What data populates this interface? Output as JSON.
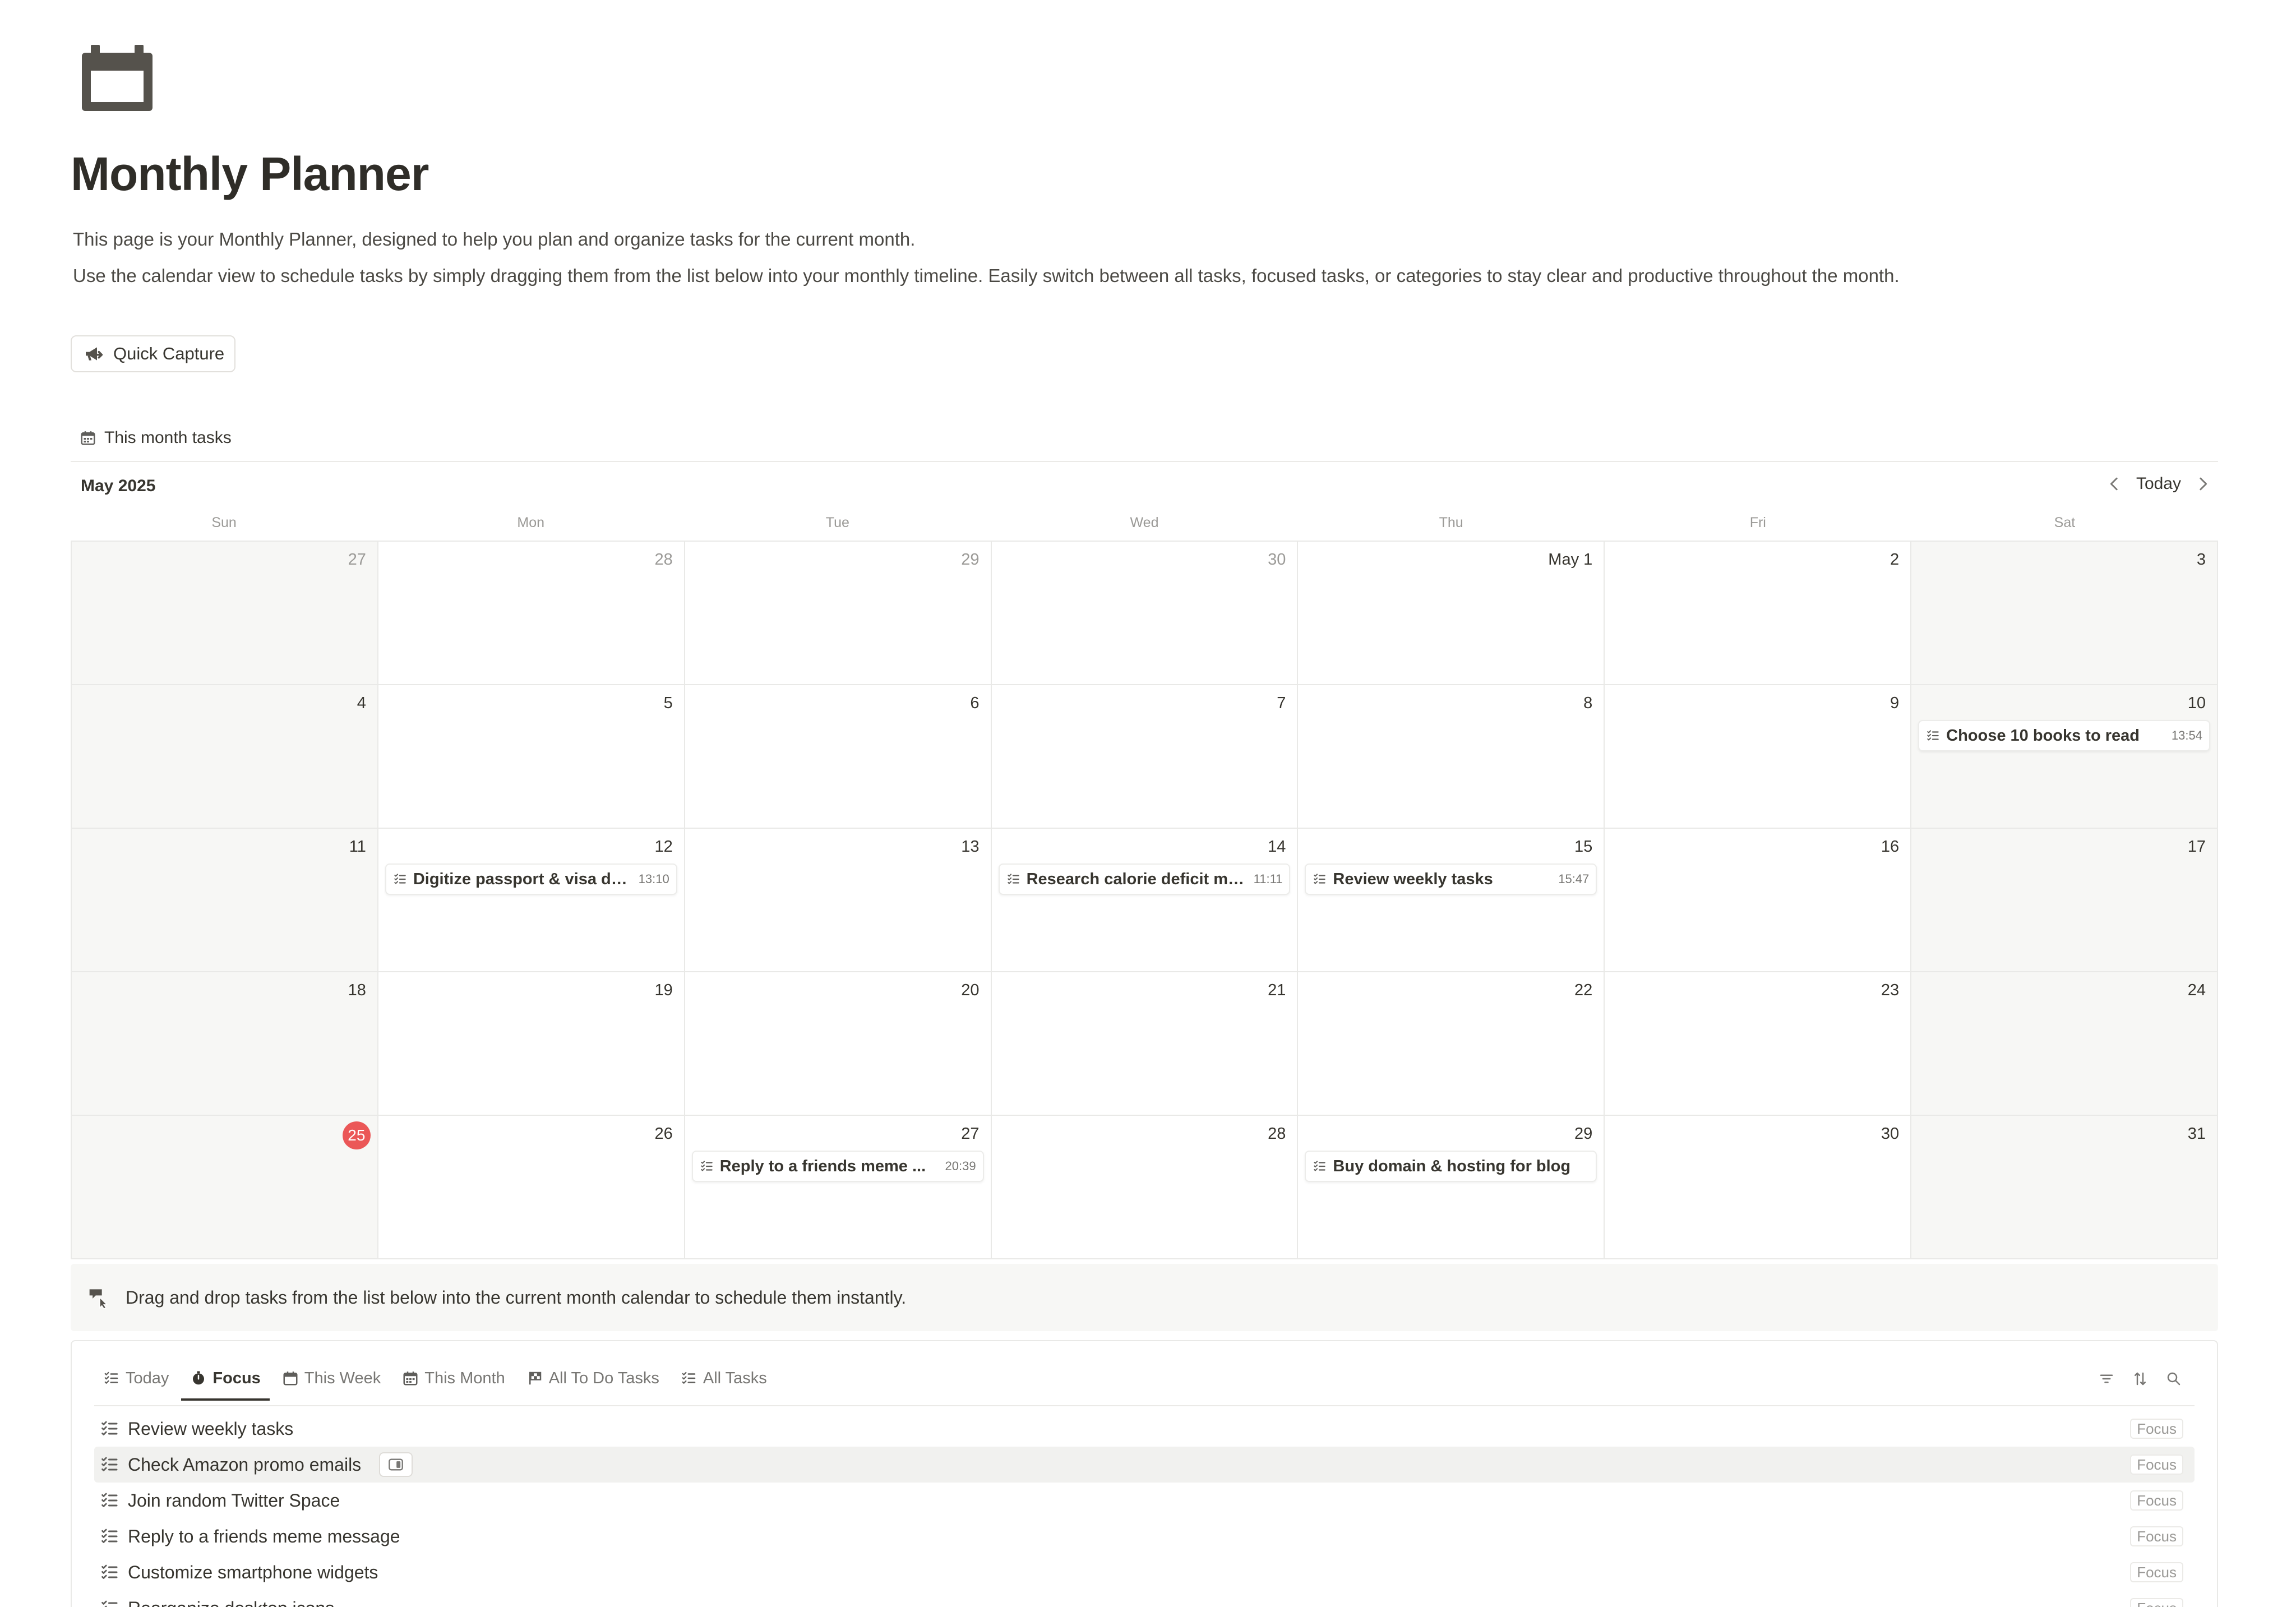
{
  "page": {
    "icon": "calendar-icon",
    "title": "Monthly Planner",
    "description_1": "This page is your Monthly Planner, designed to help you plan and organize tasks for the current month.",
    "description_2": "Use the calendar view to schedule tasks by simply dragging them from the list below into your monthly timeline. Easily switch between all tasks, focused tasks, or categories to stay clear and productive throughout the month."
  },
  "quick_capture": {
    "label": "Quick Capture",
    "icon": "megaphone-arrow-icon"
  },
  "calendar_view": {
    "title": "This month tasks",
    "month": "May 2025",
    "today_label": "Today",
    "weekdays": [
      "Sun",
      "Mon",
      "Tue",
      "Wed",
      "Thu",
      "Fri",
      "Sat"
    ],
    "days": [
      "27",
      "28",
      "29",
      "30",
      "May 1",
      "2",
      "3",
      "4",
      "5",
      "6",
      "7",
      "8",
      "9",
      "10",
      "11",
      "12",
      "13",
      "14",
      "15",
      "16",
      "17",
      "18",
      "19",
      "20",
      "21",
      "22",
      "23",
      "24",
      "25",
      "26",
      "27",
      "28",
      "29",
      "30",
      "31"
    ],
    "events": {
      "10": {
        "title": "Choose 10 books to read",
        "time": "13:54"
      },
      "12": {
        "title": "Digitize passport & visa do...",
        "time": "13:10"
      },
      "14": {
        "title": "Research calorie deficit me...",
        "time": "11:11"
      },
      "15": {
        "title": "Review weekly tasks",
        "time": "15:47"
      },
      "27": {
        "title": "Reply to a friends meme ...",
        "time": "20:39"
      },
      "29": {
        "title": "Buy domain & hosting for blog",
        "time": ""
      }
    },
    "today_day": "25"
  },
  "callout": {
    "icon": "hand-pointer-icon",
    "text": "Drag and drop tasks from the list below into the current month calendar to schedule them instantly."
  },
  "task_list": {
    "tabs": [
      {
        "label": "Today",
        "icon": "checklist-icon"
      },
      {
        "label": "Focus",
        "icon": "timer-icon"
      },
      {
        "label": "This Week",
        "icon": "calendar-icon"
      },
      {
        "label": "This Month",
        "icon": "calendar-grid-icon"
      },
      {
        "label": "All To Do Tasks",
        "icon": "flag-icon"
      },
      {
        "label": "All Tasks",
        "icon": "checklist-icon"
      }
    ],
    "active_tab": "Focus",
    "rows": [
      {
        "title": "Review weekly tasks",
        "tag": "Focus"
      },
      {
        "title": "Check Amazon promo emails",
        "tag": "Focus"
      },
      {
        "title": "Join random Twitter Space",
        "tag": "Focus"
      },
      {
        "title": "Reply to a friends meme message",
        "tag": "Focus"
      },
      {
        "title": "Customize smartphone widgets",
        "tag": "Focus"
      },
      {
        "title": "Reorganize desktop icons",
        "tag": "Focus"
      }
    ]
  },
  "colors": {
    "text": "#37352f",
    "muted": "#9b9a97",
    "weekend_bg": "#f7f7f5",
    "today_badge": "#eb5757",
    "grid_line": "#e9e9e7"
  }
}
